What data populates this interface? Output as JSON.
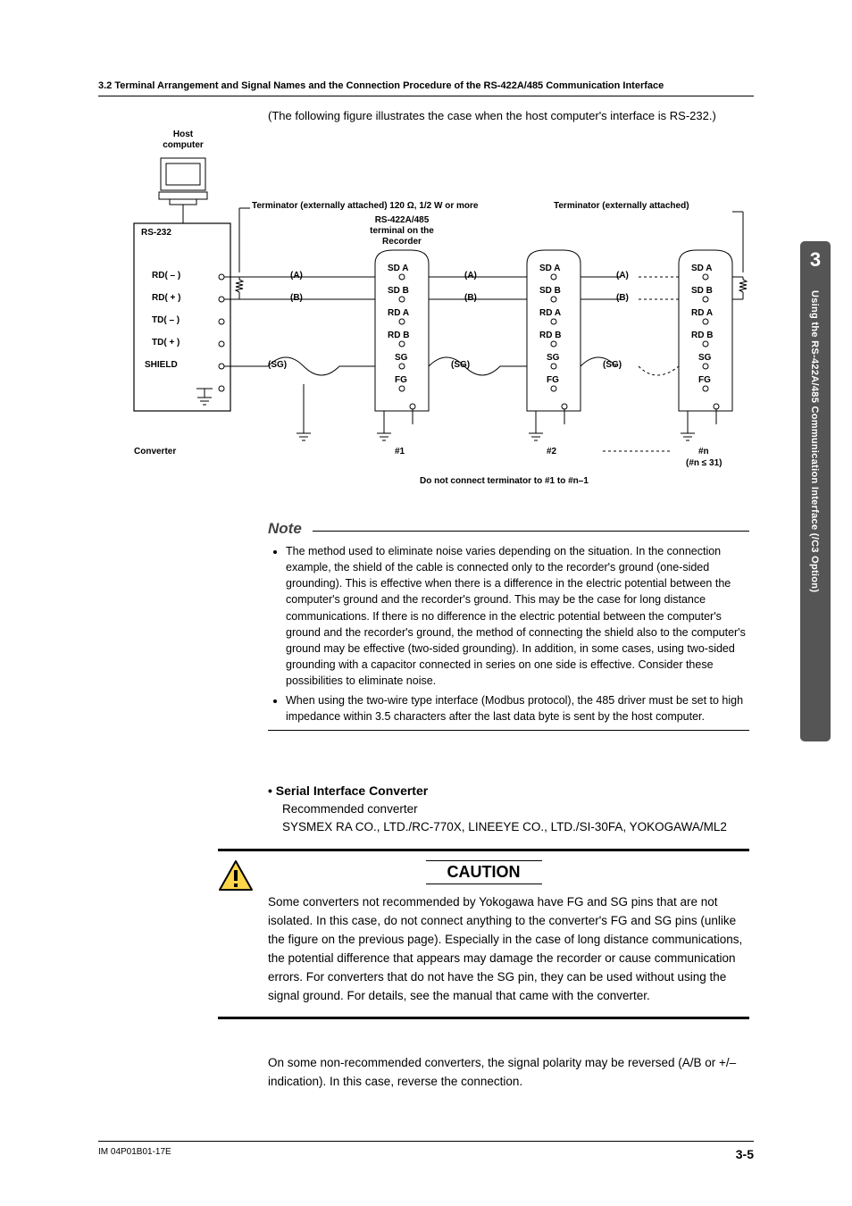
{
  "header": "3.2  Terminal Arrangement and Signal Names and the Connection Procedure of the RS-422A/485 Communication Interface",
  "intro": "(The following figure illustrates the case when the host computer's interface is RS-232.)",
  "diagram": {
    "host_label1": "Host",
    "host_label2": "computer",
    "rs232": "RS-232",
    "term_left": "Terminator (externally attached) 120 Ω, 1/2 W or more",
    "term_right": "Terminator (externally attached)",
    "rs422_l1": "RS-422A/485",
    "rs422_l2": "terminal on the",
    "rs422_l3": "Recorder",
    "conv_pins": [
      "RD( – )",
      "RD( + )",
      "TD( – )",
      "TD( + )",
      "SHIELD"
    ],
    "rec_pins": [
      "SD A",
      "SD B",
      "RD A",
      "RD B",
      "SG",
      "FG"
    ],
    "wires": {
      "a": "(A)",
      "b": "(B)",
      "sg": "(SG)"
    },
    "converter": "Converter",
    "unit1": "#1",
    "unit2": "#2",
    "unitn": "#n",
    "unitn_sub": "(#n ≤ 31)",
    "term_note": "Do not connect terminator to #1 to #n–1"
  },
  "side_tab": {
    "num": "3",
    "text": "Using the RS-422A/485 Communication Interface (/C3 Option)"
  },
  "note": {
    "label": "Note",
    "items": [
      "The method used to eliminate noise varies depending on the situation. In the connection example, the shield of the cable is connected only to the recorder's ground (one-sided grounding). This is effective when there is a difference in the electric potential between the computer's ground and the recorder's ground. This may be the case for long distance communications. If there is no difference in the electric potential between the computer's ground and the recorder's ground, the method of connecting the shield also to the computer's ground may be effective (two-sided grounding). In addition, in some cases, using two-sided grounding with a capacitor connected in series on one side is effective. Consider these possibilities to eliminate noise.",
      "When using the two-wire type interface (Modbus protocol), the 485 driver must be set to high impedance within 3.5 characters after the last data byte is sent by the host computer."
    ]
  },
  "serial": {
    "title": "•  Serial Interface Converter",
    "sub": "Recommended converter",
    "line": "SYSMEX RA CO., LTD./RC-770X,  LINEEYE CO., LTD./SI-30FA,  YOKOGAWA/ML2"
  },
  "caution": {
    "title": "CAUTION",
    "body": "Some converters not recommended by Yokogawa have FG and SG pins that are not isolated. In this case, do not connect anything to the converter's FG and SG pins (unlike the figure on the previous page). Especially in the case of long distance communications, the potential difference that appears may damage the recorder or cause communication errors. For converters that do not have the SG pin, they can be used without using the signal ground. For details, see the manual that came with the converter."
  },
  "post_caution": "On some non-recommended converters, the signal polarity may be reversed (A/B or +/– indication). In this case, reverse the connection.",
  "footer": {
    "code": "IM 04P01B01-17E",
    "page": "3-5"
  }
}
